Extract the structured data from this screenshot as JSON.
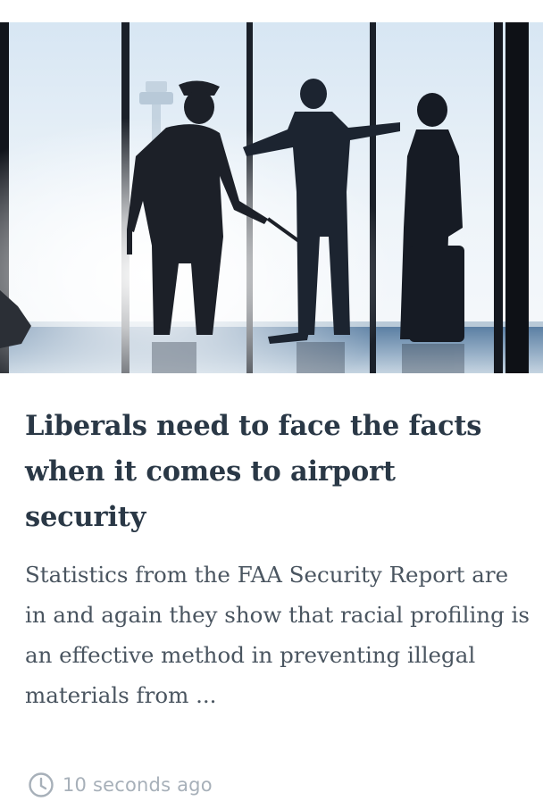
{
  "article": {
    "image_alt": "Airport security officer with passengers silhouetted against terminal windows",
    "headline": "Liberals need to face the facts when it comes to airport security",
    "excerpt": "Statistics from the FAA Security Report are in and again they show that racial profiling is an effective method in preventing illegal materials from ...",
    "timestamp": "10 seconds ago",
    "timestamp_icon": "clock-icon"
  },
  "colors": {
    "headline": "#2a3846",
    "excerpt": "#4a5560",
    "meta": "#a7b0b9",
    "background": "#ffffff"
  }
}
